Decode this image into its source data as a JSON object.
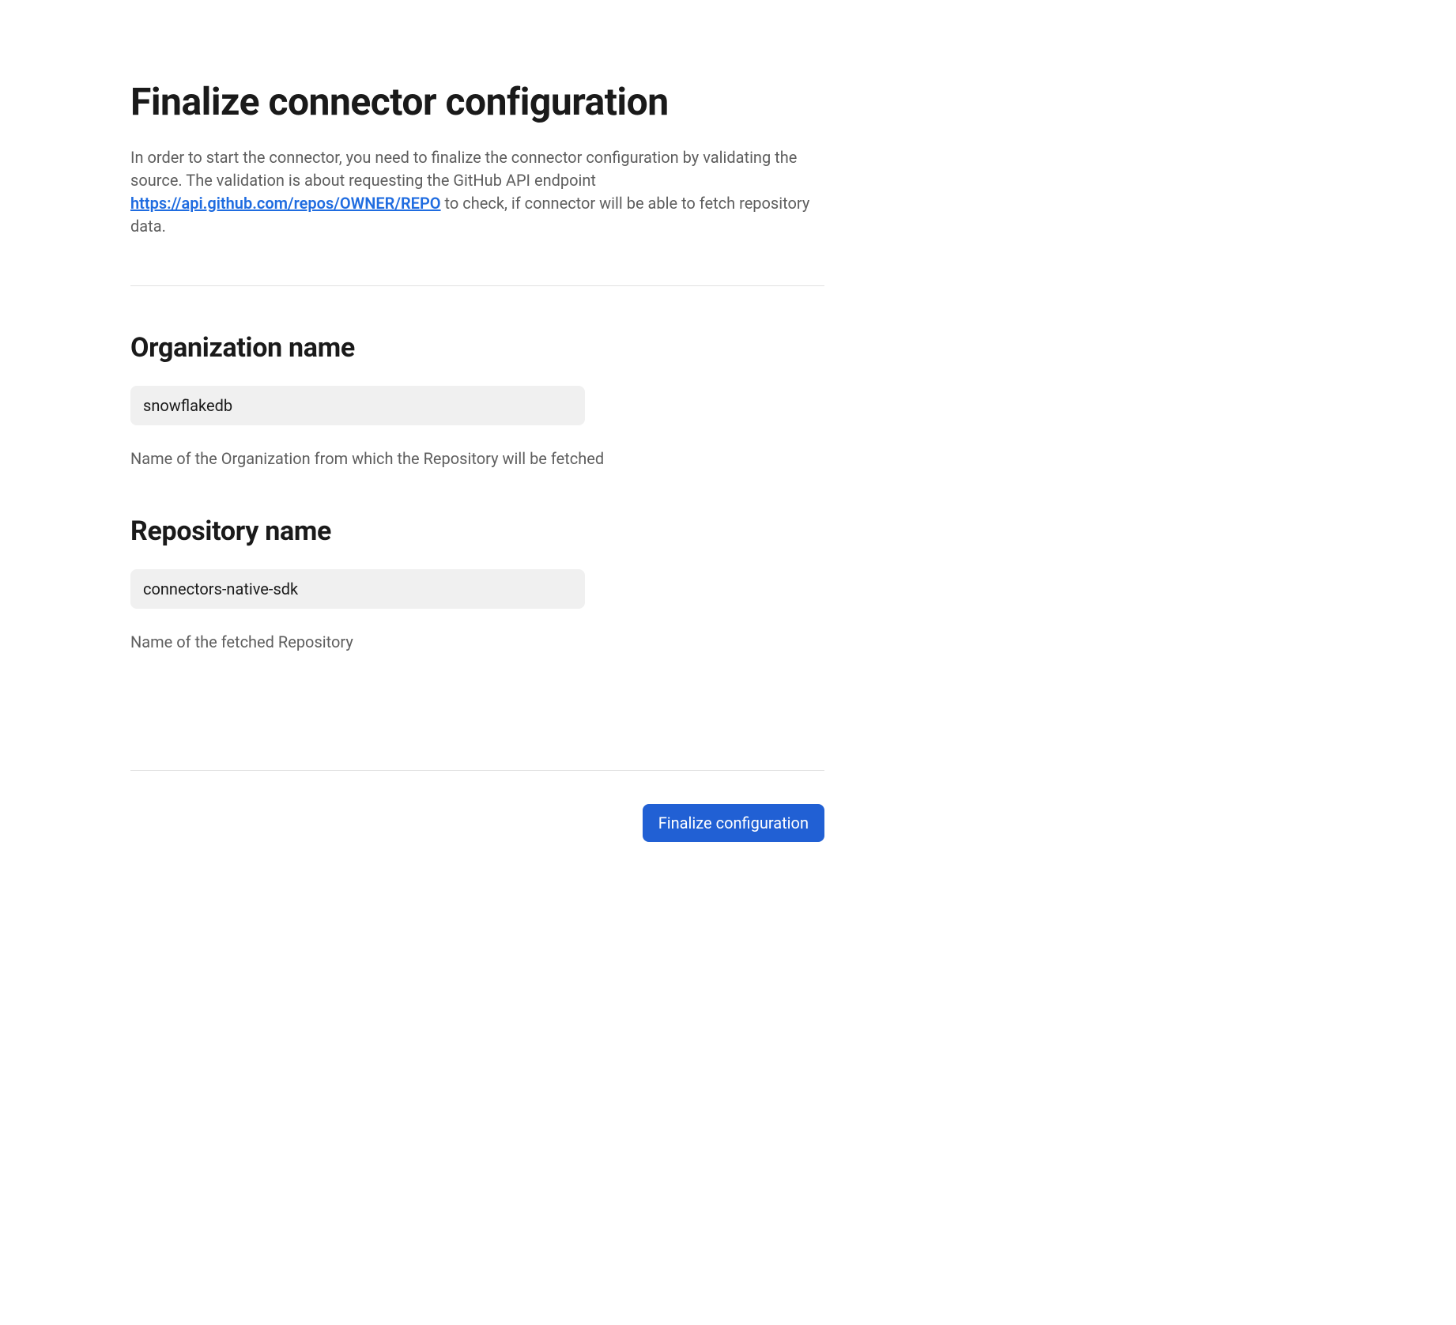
{
  "header": {
    "title": "Finalize connector configuration",
    "description_prefix": "In order to start the connector, you need to finalize the connector configuration by validating the source. The validation is about requesting the GitHub API endpoint ",
    "description_link": "https://api.github.com/repos/OWNER/REPO",
    "description_suffix": " to check, if connector will be able to fetch repository data."
  },
  "form": {
    "organization": {
      "label": "Organization name",
      "value": "snowflakedb",
      "help": "Name of the Organization from which the Repository will be fetched"
    },
    "repository": {
      "label": "Repository name",
      "value": "connectors-native-sdk",
      "help": "Name of the fetched Repository"
    }
  },
  "actions": {
    "finalize_label": "Finalize configuration"
  }
}
